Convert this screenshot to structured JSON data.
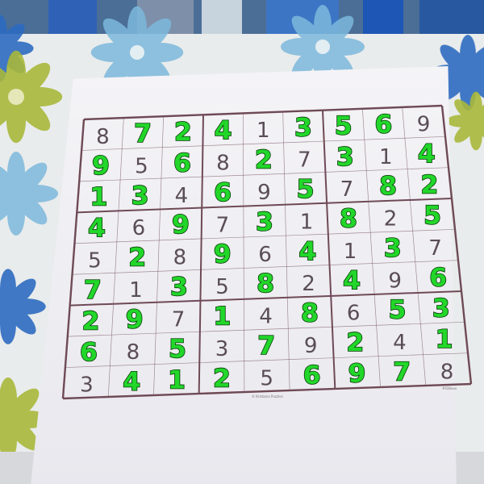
{
  "grid": {
    "rows": [
      [
        "8",
        "7",
        "2",
        "4",
        "1",
        "3",
        "5",
        "6",
        "9"
      ],
      [
        "9",
        "5",
        "6",
        "8",
        "2",
        "7",
        "3",
        "1",
        "4"
      ],
      [
        "1",
        "3",
        "4",
        "6",
        "9",
        "5",
        "7",
        "8",
        "2"
      ],
      [
        "4",
        "6",
        "9",
        "7",
        "3",
        "1",
        "8",
        "2",
        "5"
      ],
      [
        "5",
        "2",
        "8",
        "9",
        "6",
        "4",
        "1",
        "3",
        "7"
      ],
      [
        "7",
        "1",
        "3",
        "5",
        "8",
        "2",
        "4",
        "9",
        "6"
      ],
      [
        "2",
        "9",
        "7",
        "1",
        "4",
        "8",
        "6",
        "5",
        "3"
      ],
      [
        "6",
        "8",
        "5",
        "3",
        "7",
        "9",
        "2",
        "4",
        "1"
      ],
      [
        "3",
        "4",
        "1",
        "2",
        "5",
        "6",
        "9",
        "7",
        "8"
      ]
    ],
    "handwritten": [
      [
        0,
        1,
        1,
        1,
        0,
        1,
        1,
        1,
        0
      ],
      [
        1,
        0,
        1,
        0,
        1,
        0,
        1,
        0,
        1
      ],
      [
        1,
        1,
        0,
        1,
        0,
        1,
        0,
        1,
        1
      ],
      [
        1,
        0,
        1,
        0,
        1,
        0,
        1,
        0,
        1
      ],
      [
        0,
        1,
        0,
        1,
        0,
        1,
        0,
        1,
        0
      ],
      [
        1,
        0,
        1,
        0,
        1,
        0,
        1,
        0,
        1
      ],
      [
        1,
        1,
        0,
        1,
        0,
        1,
        0,
        1,
        1
      ],
      [
        1,
        0,
        1,
        0,
        1,
        0,
        1,
        0,
        1
      ],
      [
        0,
        1,
        1,
        1,
        0,
        1,
        1,
        1,
        0
      ]
    ]
  },
  "colors": {
    "printed_digit": "#5a4e55",
    "handwritten_digit": "#22d62a",
    "grid_line": "#6e4a55",
    "paper": "#f4f3f6"
  },
  "footer": {
    "credit": "© Kristanix Puzzles",
    "code": "#436xxx"
  }
}
